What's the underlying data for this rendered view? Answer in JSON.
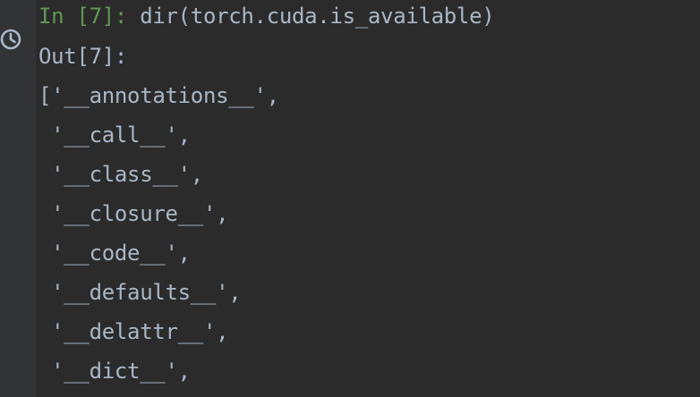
{
  "input_prompt": "In [7]:",
  "input_command": "dir(torch.cuda.is_available)",
  "output_prompt": "Out[7]:",
  "output_lines": [
    "['__annotations__',",
    " '__call__',",
    " '__class__',",
    " '__closure__',",
    " '__code__',",
    " '__defaults__',",
    " '__delattr__',",
    " '__dict__',"
  ],
  "colors": {
    "background": "#2b2b2b",
    "gutter": "#313335",
    "prompt_in": "#629755",
    "text": "#a9b7c6"
  },
  "icons": {
    "gutter": "history-clock-icon"
  }
}
